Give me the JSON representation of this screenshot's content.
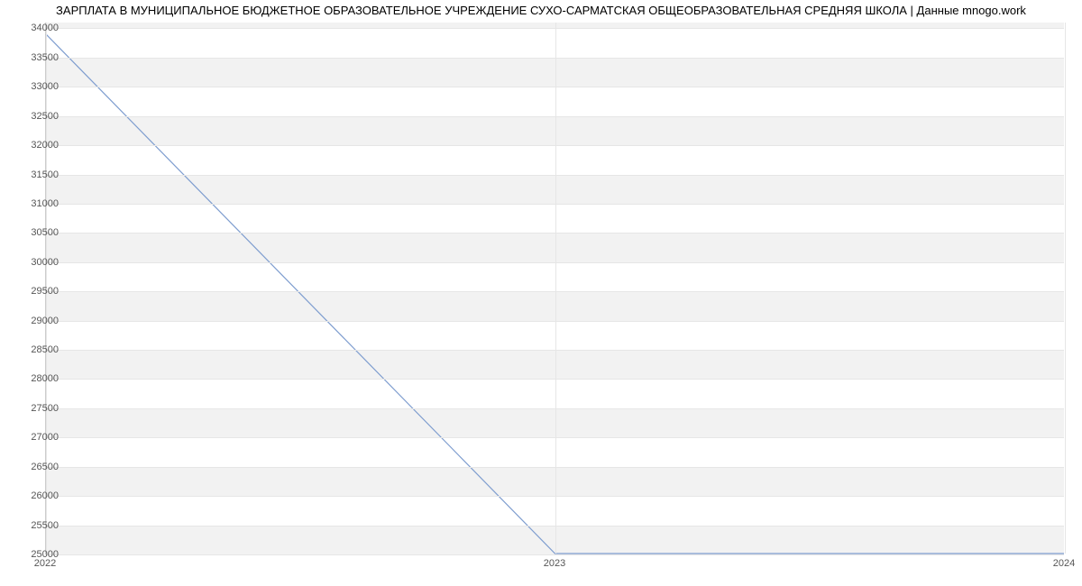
{
  "chart_data": {
    "type": "line",
    "title": "ЗАРПЛАТА В МУНИЦИПАЛЬНОЕ БЮДЖЕТНОЕ ОБРАЗОВАТЕЛЬНОЕ УЧРЕЖДЕНИЕ СУХО-САРМАТСКАЯ  ОБЩЕОБРАЗОВАТЕЛЬНАЯ СРЕДНЯЯ ШКОЛА | Данные mnogo.work",
    "xlabel": "",
    "ylabel": "",
    "x": [
      2022,
      2023,
      2024
    ],
    "series": [
      {
        "name": "salary",
        "values": [
          33900,
          25000,
          25000
        ]
      }
    ],
    "y_ticks": [
      25000,
      25500,
      26000,
      26500,
      27000,
      27500,
      28000,
      28500,
      29000,
      29500,
      30000,
      30500,
      31000,
      31500,
      32000,
      32500,
      33000,
      33500,
      34000
    ],
    "x_ticks": [
      2022,
      2023,
      2024
    ],
    "ylim": [
      25000,
      34100
    ],
    "xlim": [
      2022,
      2024
    ]
  }
}
